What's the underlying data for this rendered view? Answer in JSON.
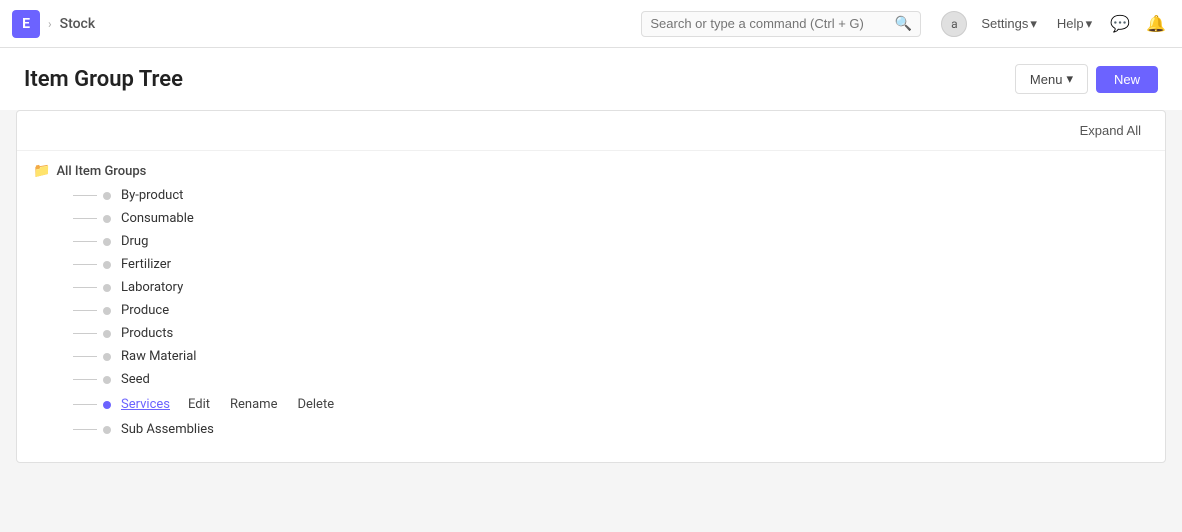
{
  "navbar": {
    "app_letter": "E",
    "chevron": "›",
    "module": "Stock",
    "search_placeholder": "Search or type a command (Ctrl + G)",
    "search_icon": "🔍",
    "avatar_letter": "a",
    "settings_label": "Settings",
    "help_label": "Help",
    "dropdown_arrow": "▾",
    "chat_icon": "💬",
    "bell_icon": "🔔"
  },
  "page": {
    "title": "Item Group Tree",
    "menu_button": "Menu",
    "new_button": "New",
    "expand_all": "Expand All"
  },
  "tree": {
    "root_label": "All Item Groups",
    "items": [
      {
        "label": "By-product",
        "selected": false
      },
      {
        "label": "Consumable",
        "selected": false
      },
      {
        "label": "Drug",
        "selected": false
      },
      {
        "label": "Fertilizer",
        "selected": false
      },
      {
        "label": "Laboratory",
        "selected": false
      },
      {
        "label": "Produce",
        "selected": false
      },
      {
        "label": "Products",
        "selected": false
      },
      {
        "label": "Raw Material",
        "selected": false
      },
      {
        "label": "Seed",
        "selected": false
      },
      {
        "label": "Services",
        "selected": true
      },
      {
        "label": "Sub Assemblies",
        "selected": false
      }
    ],
    "context_menu": {
      "edit": "Edit",
      "rename": "Rename",
      "delete": "Delete"
    }
  }
}
